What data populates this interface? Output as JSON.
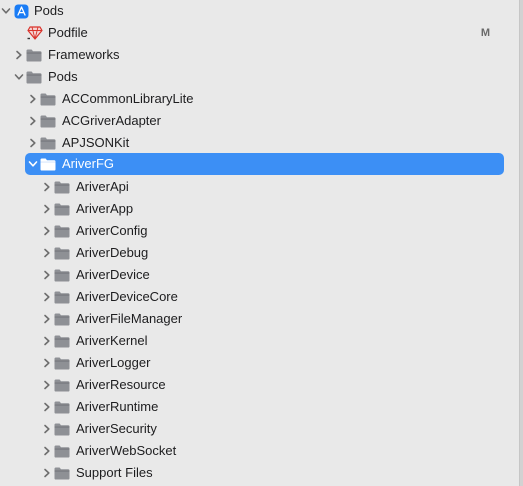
{
  "project_navigator": {
    "root": {
      "label": "Pods"
    },
    "podfile": {
      "label": "Podfile",
      "status": "M"
    },
    "frameworks": {
      "label": "Frameworks"
    },
    "pods_group": {
      "label": "Pods"
    },
    "pods": [
      {
        "label": "ACCommonLibraryLite"
      },
      {
        "label": "ACGriverAdapter"
      },
      {
        "label": "APJSONKit"
      }
    ],
    "selected_pod": {
      "label": "AriverFG"
    },
    "subfolders": [
      {
        "label": "AriverApi"
      },
      {
        "label": "AriverApp"
      },
      {
        "label": "AriverConfig"
      },
      {
        "label": "AriverDebug"
      },
      {
        "label": "AriverDevice"
      },
      {
        "label": "AriverDeviceCore"
      },
      {
        "label": "AriverFileManager"
      },
      {
        "label": "AriverKernel"
      },
      {
        "label": "AriverLogger"
      },
      {
        "label": "AriverResource"
      },
      {
        "label": "AriverRuntime"
      },
      {
        "label": "AriverSecurity"
      },
      {
        "label": "AriverWebSocket"
      },
      {
        "label": "Support Files"
      }
    ],
    "colors": {
      "selection": "#3c8ff5",
      "folder": "#8e9095",
      "app_icon": "#1a7cf5",
      "ruby_icon": "#d9332b"
    }
  }
}
